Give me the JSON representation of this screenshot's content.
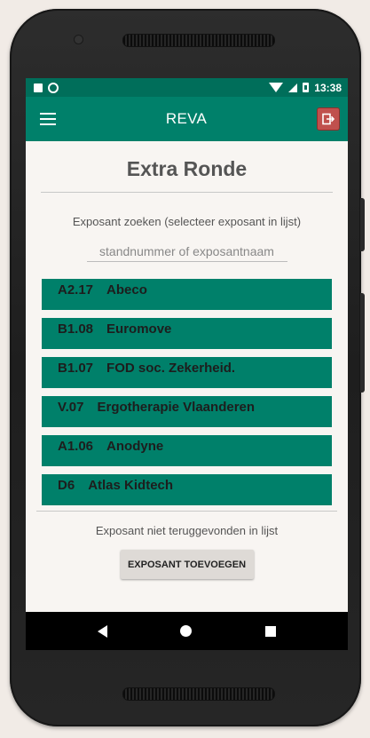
{
  "status_bar": {
    "time": "13:38"
  },
  "app_bar": {
    "title": "REVA",
    "menu_icon": "hamburger-menu-icon",
    "logout_icon": "logout-icon"
  },
  "main": {
    "title": "Extra Ronde",
    "search_label": "Exposant zoeken (selecteer exposant in lijst)",
    "search_placeholder": "standnummer of exposantnaam",
    "search_value": "",
    "exhibitors": [
      {
        "code": "A2.17",
        "name": "Abeco"
      },
      {
        "code": "B1.08",
        "name": "Euromove"
      },
      {
        "code": "B1.07",
        "name": "FOD soc. Zekerheid."
      },
      {
        "code": "V.07",
        "name": "Ergotherapie Vlaanderen"
      },
      {
        "code": "A1.06",
        "name": "Anodyne"
      },
      {
        "code": "D6",
        "name": "Atlas Kidtech"
      }
    ],
    "not_found_text": "Exposant niet teruggevonden in lijst",
    "add_button_label": "EXPOSANT TOEVOEGEN"
  },
  "colors": {
    "accent": "#00806a",
    "status_bar": "#006e5a",
    "logout": "#c0504d"
  }
}
